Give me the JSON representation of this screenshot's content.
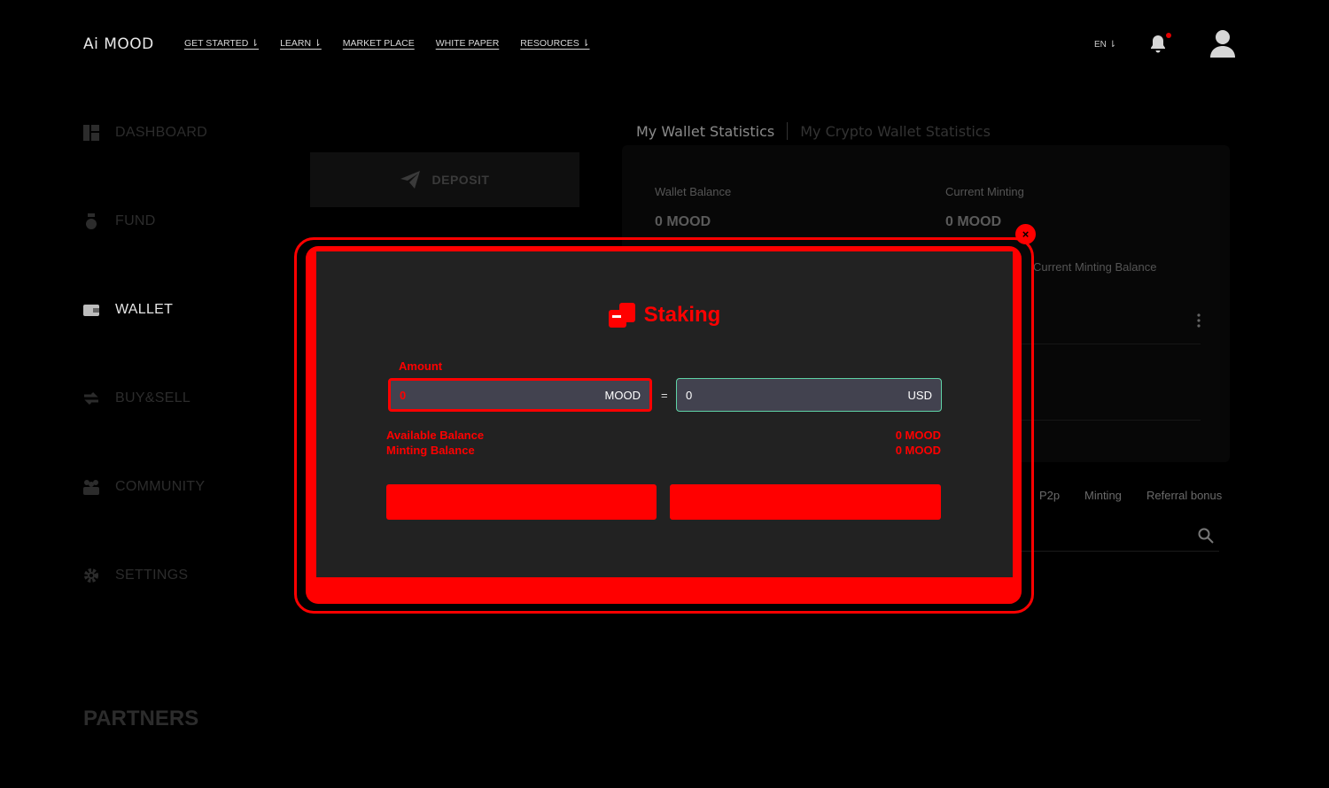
{
  "header": {
    "logo": "Ai MOOD",
    "nav": [
      {
        "label": "GET STARTED ⇂"
      },
      {
        "label": "LEARN ⇂"
      },
      {
        "label": "MARKET PLACE"
      },
      {
        "label": "WHITE PAPER"
      },
      {
        "label": "RESOURCES ⇂"
      }
    ],
    "language": "EN ⇂"
  },
  "sidebar": {
    "items": [
      {
        "label": "DASHBOARD",
        "icon": "dashboard-icon"
      },
      {
        "label": "FUND",
        "icon": "money-bag-icon"
      },
      {
        "label": "WALLET",
        "icon": "wallet-icon",
        "active": true
      },
      {
        "label": "BUY&SELL",
        "icon": "exchange-icon"
      },
      {
        "label": "COMMUNITY",
        "icon": "people-icon"
      },
      {
        "label": "SETTINGS",
        "icon": "gear-icon"
      }
    ],
    "partners": "PARTNERS"
  },
  "main": {
    "deposit_label": "DEPOSIT",
    "stats_tabs": [
      "My Wallet Statistics",
      "My Crypto Wallet Statistics"
    ],
    "stats": {
      "wallet_balance_label": "Wallet Balance",
      "wallet_balance_value": "0 MOOD",
      "current_minting_label": "Current Minting",
      "current_minting_value": "0 MOOD",
      "current_minting_balance_label": "Current Minting Balance"
    },
    "filters": [
      "P2p",
      "Minting",
      "Referral bonus"
    ]
  },
  "modal": {
    "title": "Staking",
    "amount_label": "Amount",
    "mood_value": "0",
    "mood_unit": "MOOD",
    "equals": "=",
    "usd_value": "0",
    "usd_unit": "USD",
    "available_balance_label": "Available Balance",
    "available_balance_value": "0 MOOD",
    "minting_balance_label": "Minting Balance",
    "minting_balance_value": "0 MOOD",
    "close": "×",
    "cancel_label": "",
    "confirm_label": ""
  },
  "colors": {
    "accent": "#ff0000",
    "usd_border": "#5fd3a6",
    "modal_bg": "#222222"
  }
}
